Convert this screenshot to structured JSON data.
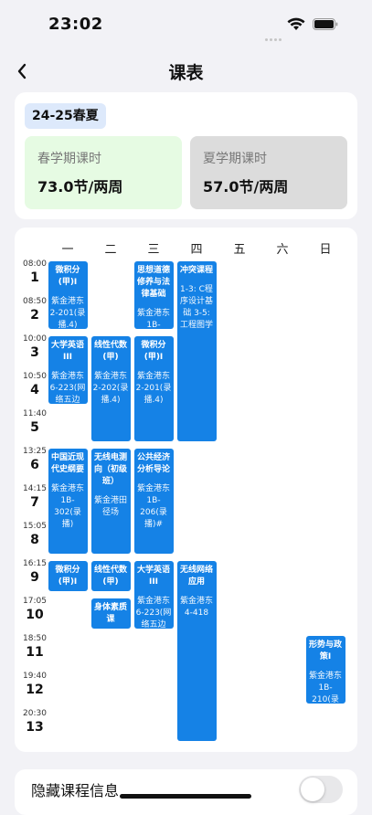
{
  "status": {
    "time": "23:02"
  },
  "nav": {
    "title": "课表"
  },
  "summary": {
    "term": "24-25春夏",
    "spring": {
      "label": "春学期课时",
      "value": "73.0节/两周"
    },
    "summer": {
      "label": "夏学期课时",
      "value": "57.0节/两周"
    },
    "colors": {
      "spring_bg": "#e6fbe3",
      "summer_bg": "#dcdcdc",
      "accent": "#1582e6"
    }
  },
  "timetable": {
    "days": [
      "一",
      "二",
      "三",
      "四",
      "五",
      "六",
      "日"
    ],
    "periods": [
      {
        "time": "08:00",
        "num": "1"
      },
      {
        "time": "08:50",
        "num": "2"
      },
      {
        "time": "10:00",
        "num": "3"
      },
      {
        "time": "10:50",
        "num": "4"
      },
      {
        "time": "11:40",
        "num": "5"
      },
      {
        "time": "13:25",
        "num": "6"
      },
      {
        "time": "14:15",
        "num": "7"
      },
      {
        "time": "15:05",
        "num": "8"
      },
      {
        "time": "16:15",
        "num": "9"
      },
      {
        "time": "17:05",
        "num": "10"
      },
      {
        "time": "18:50",
        "num": "11"
      },
      {
        "time": "19:40",
        "num": "12"
      },
      {
        "time": "20:30",
        "num": "13"
      }
    ],
    "courses": [
      {
        "name": "微积分(甲)Ⅰ",
        "room": "紫金港东2-201(录播.4)",
        "day": 1,
        "start": 1,
        "end": 2
      },
      {
        "name": "大学英语III",
        "room": "紫金港东6-223(网络五边菱)(录播)",
        "day": 1,
        "start": 3,
        "end": 4
      },
      {
        "name": "中国近现代史纲要",
        "room": "紫金港东1B-302(录播)",
        "day": 1,
        "start": 6,
        "end": 8
      },
      {
        "name": "微积分(甲)Ⅰ",
        "room": "",
        "day": 1,
        "start": 9,
        "end": 9
      },
      {
        "name": "线性代数(甲)",
        "room": "紫金港东2-202(录播.4)",
        "day": 2,
        "start": 3,
        "end": 5
      },
      {
        "name": "无线电测向（初级班）",
        "room": "紫金港田径场",
        "day": 2,
        "start": 6,
        "end": 8
      },
      {
        "name": "线性代数(甲)",
        "room": "",
        "day": 2,
        "start": 9,
        "end": 9
      },
      {
        "name": "身体素质课",
        "room": "",
        "day": 2,
        "start": 10,
        "end": 10
      },
      {
        "name": "思想道德修养与法律基础",
        "room": "紫金港东1B-302(录播)",
        "day": 3,
        "start": 1,
        "end": 2
      },
      {
        "name": "微积分(甲)Ⅰ",
        "room": "紫金港东2-201(录播.4)",
        "day": 3,
        "start": 3,
        "end": 5
      },
      {
        "name": "公共经济分析导论",
        "room": "紫金港东1B-206(录播)#",
        "day": 3,
        "start": 6,
        "end": 8
      },
      {
        "name": "大学英语III",
        "room": "紫金港东6-223(网络五边菱)(录播)",
        "day": 3,
        "start": 9,
        "end": 10
      },
      {
        "name": "冲突课程",
        "room": "1-3: C程序设计基础 3-5: 工程图学",
        "day": 4,
        "start": 1,
        "end": 5
      },
      {
        "name": "无线网络应用",
        "room": "紫金港东4-418",
        "day": 4,
        "start": 9,
        "end": 13
      },
      {
        "name": "形势与政策Ⅰ",
        "room": "紫金港东1B-210(录播.4)#",
        "day": 7,
        "start": 11,
        "end": 12
      }
    ]
  },
  "settings": {
    "hide_info_label": "隐藏课程信息",
    "hide_info_on": false
  }
}
